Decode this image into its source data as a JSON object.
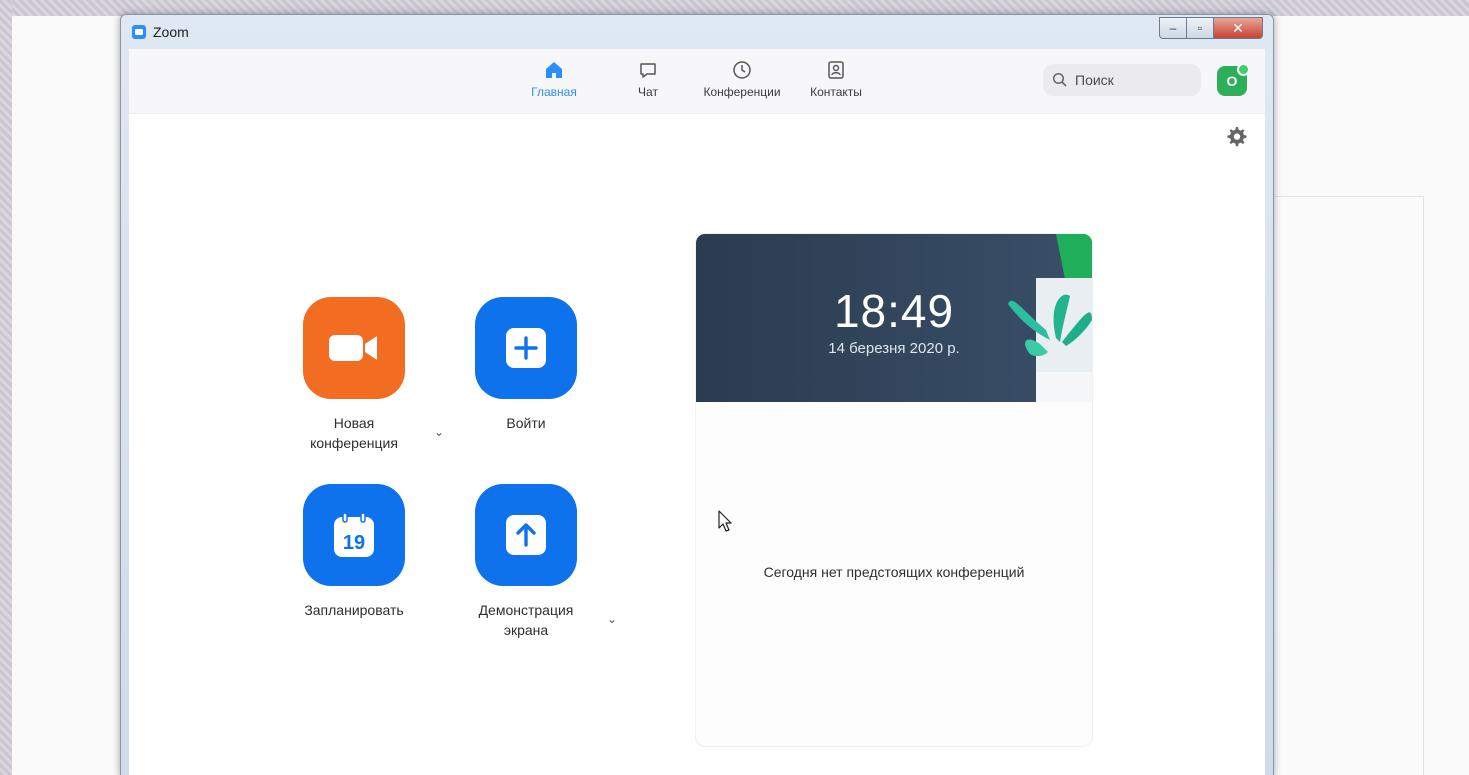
{
  "window": {
    "title": "Zoom",
    "controls": {
      "minimize": "–",
      "maximize": "▫",
      "close": "✕"
    }
  },
  "nav": {
    "items": [
      {
        "label": "Главная",
        "icon": "home-icon",
        "active": true
      },
      {
        "label": "Чат",
        "icon": "chat-icon",
        "active": false
      },
      {
        "label": "Конференции",
        "icon": "clock-icon",
        "active": false
      },
      {
        "label": "Контакты",
        "icon": "contacts-icon",
        "active": false
      }
    ],
    "search_placeholder": "Поиск",
    "avatar_initial": "О"
  },
  "actions": [
    {
      "label_line1": "Новая",
      "label_line2": "конференция",
      "color": "#f26d22",
      "icon": "video-camera-icon",
      "has_dropdown": true
    },
    {
      "label_line1": "Войти",
      "label_line2": "",
      "color": "#0e72ed",
      "icon": "plus-icon",
      "has_dropdown": false
    },
    {
      "label_line1": "Запланировать",
      "label_line2": "",
      "color": "#0e72ed",
      "icon": "calendar-icon",
      "icon_text": "19",
      "has_dropdown": false
    },
    {
      "label_line1": "Демонстрация",
      "label_line2": "экрана",
      "color": "#0e72ed",
      "icon": "share-screen-icon",
      "has_dropdown": true
    }
  ],
  "calendar_card": {
    "time": "18:49",
    "date": "14 березня 2020 р.",
    "empty_message": "Сегодня нет предстоящих конференций"
  },
  "colors": {
    "accent": "#2d8cff",
    "orange": "#f26d22",
    "blue": "#0e72ed",
    "avatar": "#2dae58",
    "banner": "#2b3c50"
  },
  "caret": "⌄"
}
